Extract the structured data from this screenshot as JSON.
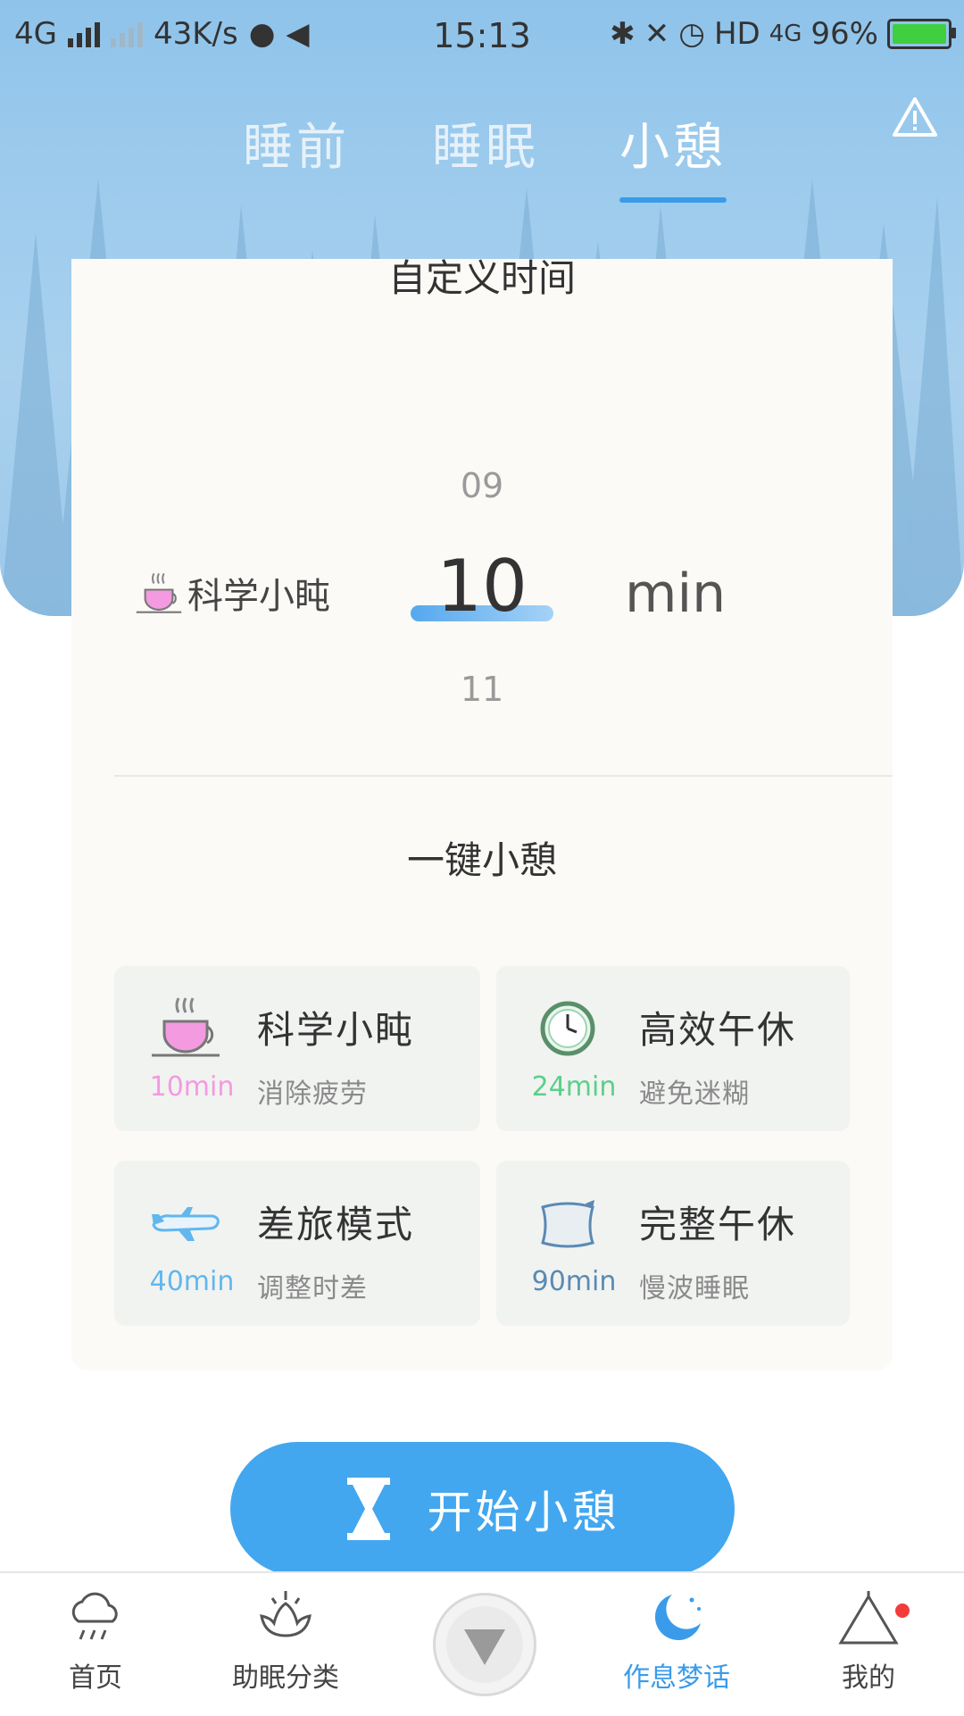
{
  "status_bar": {
    "network": "4G",
    "speed": "43K/s",
    "time": "15:13",
    "hd": "HD",
    "net2": "4G",
    "battery": "96%"
  },
  "tabs": [
    {
      "label": "睡前",
      "active": false
    },
    {
      "label": "睡眠",
      "active": false
    },
    {
      "label": "小憩",
      "active": true
    }
  ],
  "custom_time": {
    "title": "自定义时间",
    "mode_label": "科学小盹",
    "prev": "09",
    "current": "10",
    "next": "11",
    "unit": "min"
  },
  "quick_nap": {
    "title": "一键小憩",
    "options": [
      {
        "name": "科学小盹",
        "duration": "10min",
        "desc": "消除疲劳",
        "icon": "teacup-icon",
        "color": "#f39ae0"
      },
      {
        "name": "高效午休",
        "duration": "24min",
        "desc": "避免迷糊",
        "icon": "clock-icon",
        "color": "#5ccf8a"
      },
      {
        "name": "差旅模式",
        "duration": "40min",
        "desc": "调整时差",
        "icon": "airplane-icon",
        "color": "#62b7ee"
      },
      {
        "name": "完整午休",
        "duration": "90min",
        "desc": "慢波睡眠",
        "icon": "pillow-icon",
        "color": "#5a8ab3"
      }
    ]
  },
  "start_button": {
    "label": "开始小憩"
  },
  "nav": {
    "items": [
      {
        "label": "首页",
        "icon": "cloud-rain-icon"
      },
      {
        "label": "助眠分类",
        "icon": "lotus-icon"
      },
      {
        "label": "作息梦话",
        "icon": "moon-icon",
        "active": true
      },
      {
        "label": "我的",
        "icon": "tent-icon"
      }
    ]
  },
  "colors": {
    "accent": "#42a7ef",
    "badge": "#f23b3b"
  }
}
